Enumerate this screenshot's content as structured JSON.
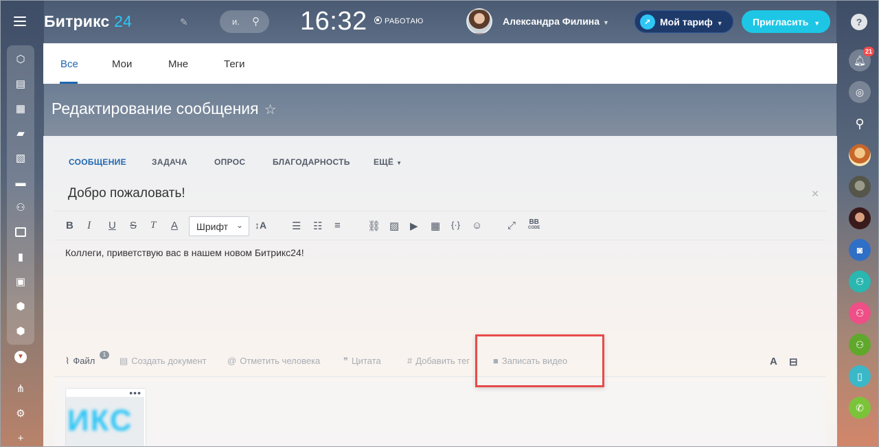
{
  "header": {
    "logo_main": "Битрикс",
    "logo_num": "24",
    "search_placeholder": "и.",
    "clock": "16:32",
    "status": "РАБОТАЮ",
    "user_name": "Александра Филина",
    "tariff": "Мой тариф",
    "invite": "Пригласить",
    "help": "?"
  },
  "feed_tabs": [
    "Все",
    "Мои",
    "Мне",
    "Теги"
  ],
  "page": {
    "title": "Редактирование сообщения"
  },
  "form_tabs": {
    "message": "СООБЩЕНИЕ",
    "task": "ЗАДАЧА",
    "poll": "ОПРОС",
    "thanks": "БЛАГОДАРНОСТЬ",
    "more": "ЕЩЁ"
  },
  "post": {
    "title": "Добро пожаловать!",
    "body": "Коллеги, приветствую вас в нашем новом Битрикс24!"
  },
  "toolbar": {
    "bold": "B",
    "italic": "I",
    "underline": "U",
    "strike": "S",
    "clear": "T",
    "color": "A",
    "font": "Шрифт",
    "size": "↕A",
    "bb": "BB",
    "bb_code": "CODE"
  },
  "attach": {
    "file": "Файл",
    "file_count": "1",
    "doc": "Создать документ",
    "mention": "Отметить человека",
    "quote": "Цитата",
    "tag": "Добавить тег",
    "video": "Записать видео",
    "text_size": "A"
  },
  "file_preview": {
    "text": "ИКС"
  },
  "notifications_count": "21",
  "colors": {
    "accent": "#2067b0",
    "logo_num": "#2fc6f6",
    "invite": "#1ec6e6",
    "tariff": "#1e3a6b",
    "highlight": "#e84a4a"
  }
}
